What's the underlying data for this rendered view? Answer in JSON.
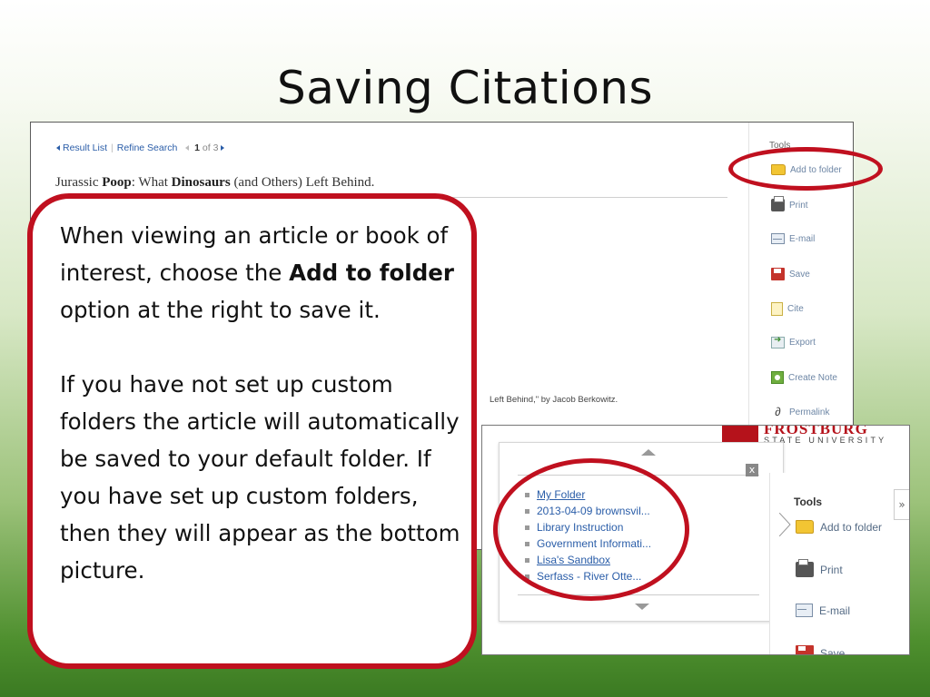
{
  "slide": {
    "title": "Saving Citations"
  },
  "top_screenshot": {
    "nav": {
      "result_list": "Result List",
      "refine_search": "Refine Search",
      "pager_current": "1",
      "pager_rest": "of 3"
    },
    "article_title": {
      "part1": "Jurassic ",
      "bold1": "Poop",
      "part2": ": What ",
      "bold2": "Dinosaurs",
      "part3": " (and Others) Left Behind."
    },
    "byline": "Left Behind,\" by Jacob Berkowitz.",
    "tools_heading": "Tools",
    "tools": [
      {
        "label": "Add to folder",
        "icon": "folder-icon"
      },
      {
        "label": "Print",
        "icon": "printer-icon"
      },
      {
        "label": "E-mail",
        "icon": "email-icon"
      },
      {
        "label": "Save",
        "icon": "save-icon"
      },
      {
        "label": "Cite",
        "icon": "cite-icon"
      },
      {
        "label": "Export",
        "icon": "export-icon"
      },
      {
        "label": "Create Note",
        "icon": "note-icon"
      },
      {
        "label": "Permalink",
        "icon": "link-icon"
      }
    ]
  },
  "bottom_screenshot": {
    "brand": {
      "name": "FROSTBURG",
      "subtitle": "STATE UNIVERSITY"
    },
    "popup": {
      "close_label": "x",
      "folders": [
        "My Folder",
        "2013-04-09 brownsvil...",
        "Library Instruction",
        "Government Informati...",
        "Lisa's Sandbox",
        "Serfass - River Otte..."
      ]
    },
    "tools_heading": "Tools",
    "collapse_label": "»",
    "tools": [
      {
        "label": "Add to folder",
        "icon": "folder-icon"
      },
      {
        "label": "Print",
        "icon": "printer-icon"
      },
      {
        "label": "E-mail",
        "icon": "email-icon"
      },
      {
        "label": "Save",
        "icon": "save-icon"
      }
    ]
  },
  "callout": {
    "p1_a": "When viewing an article or book of interest, choose the ",
    "p1_bold": "Add to folder",
    "p1_b": " option at the right to save it.",
    "p2": "If you have not set up custom folders the article will automatically be saved to your default folder.  If you have set up custom folders, then they will appear as the bottom picture."
  },
  "colors": {
    "highlight_red": "#c0101f",
    "link_blue": "#2a5da8",
    "brand_red": "#b5121b"
  }
}
